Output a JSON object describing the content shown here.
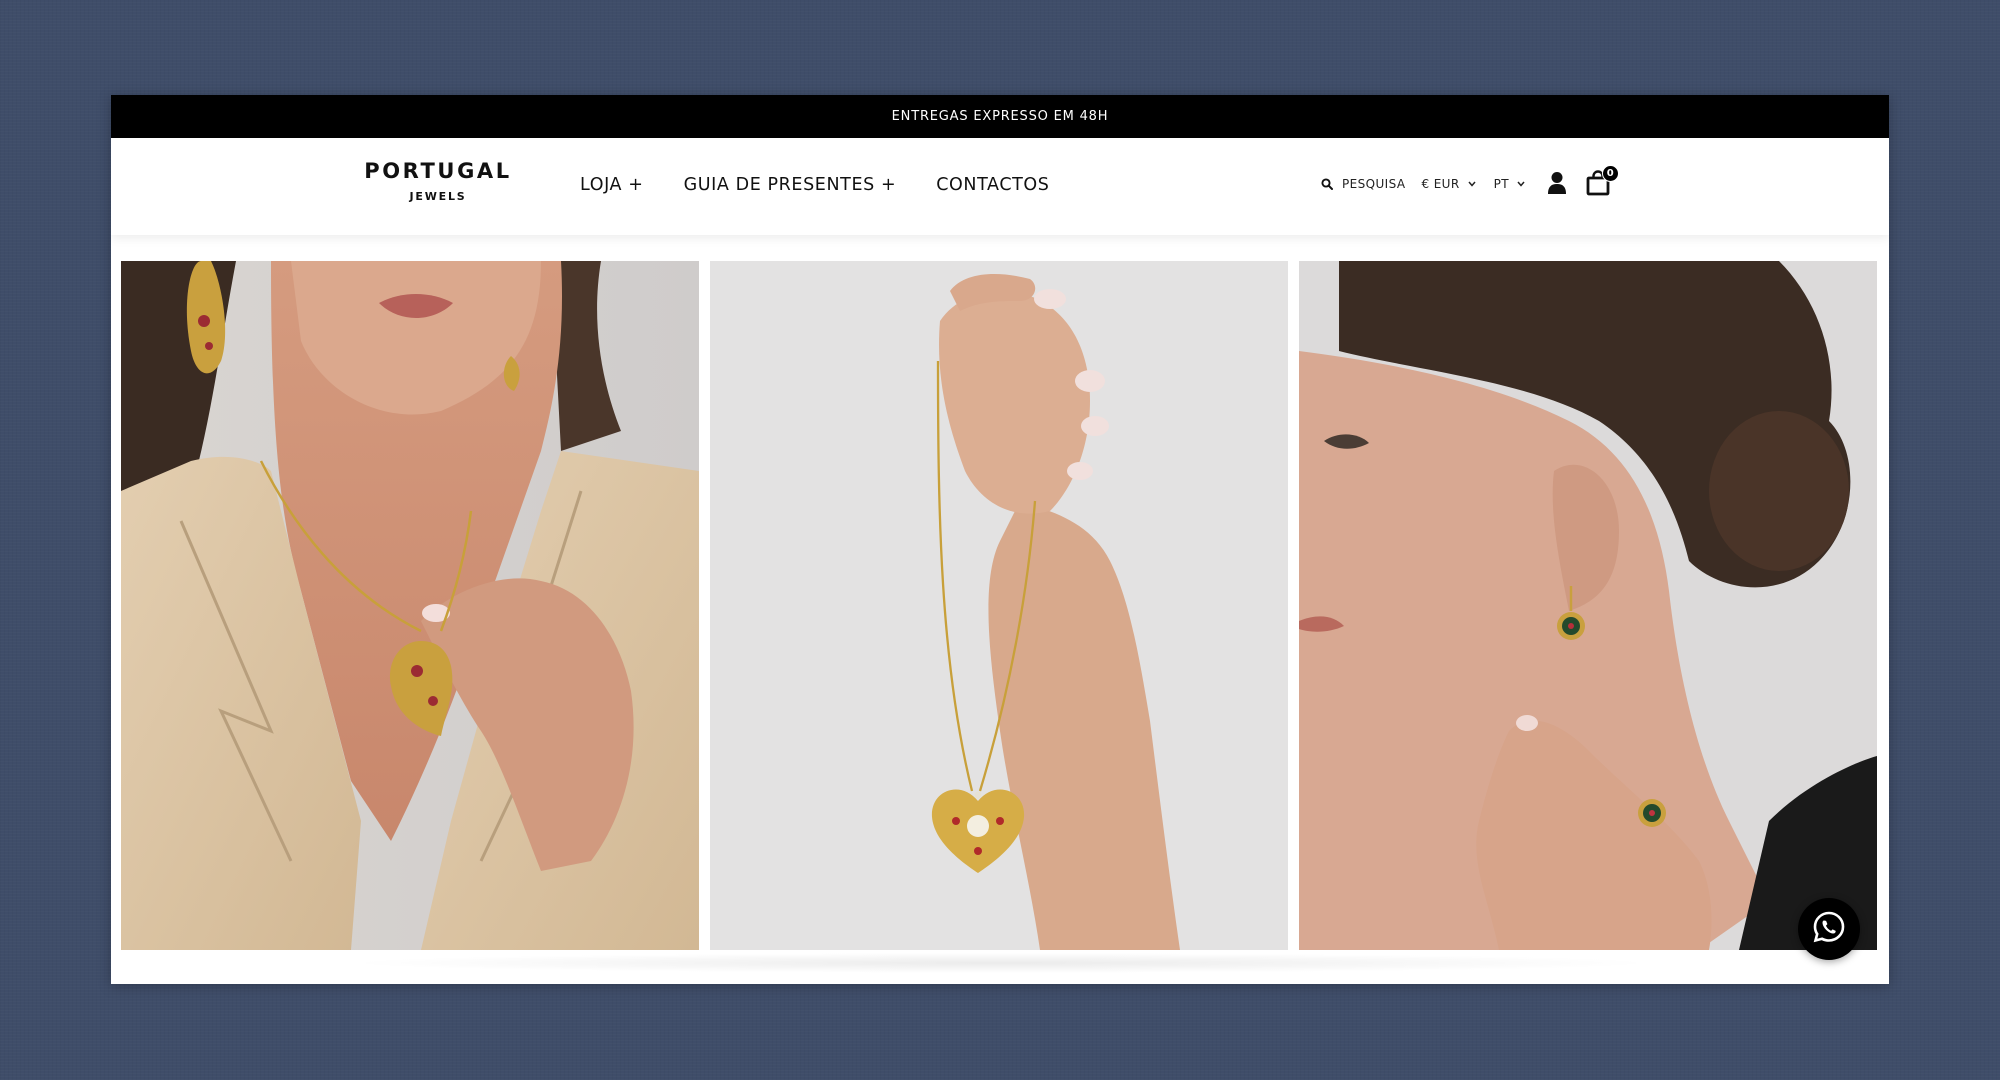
{
  "announcement": "ENTREGAS EXPRESSO EM 48H",
  "logo": {
    "main": "PORTUGAL",
    "sub": "JEWELS"
  },
  "nav": [
    {
      "label": "LOJA +"
    },
    {
      "label": "GUIA DE PRESENTES +"
    },
    {
      "label": "CONTACTOS"
    }
  ],
  "tools": {
    "search_label": "PESQUISA",
    "currency": "€ EUR",
    "language": "PT",
    "cart_count": "0"
  },
  "icons": {
    "search": "search-icon",
    "chevron": "chevron-down-icon",
    "account": "user-icon",
    "cart": "shopping-bag-icon",
    "whatsapp": "whatsapp-icon"
  },
  "colors": {
    "background": "#3f4d69",
    "announcement_bar": "#000000",
    "text": "#111111",
    "whatsapp_button": "#000000"
  }
}
